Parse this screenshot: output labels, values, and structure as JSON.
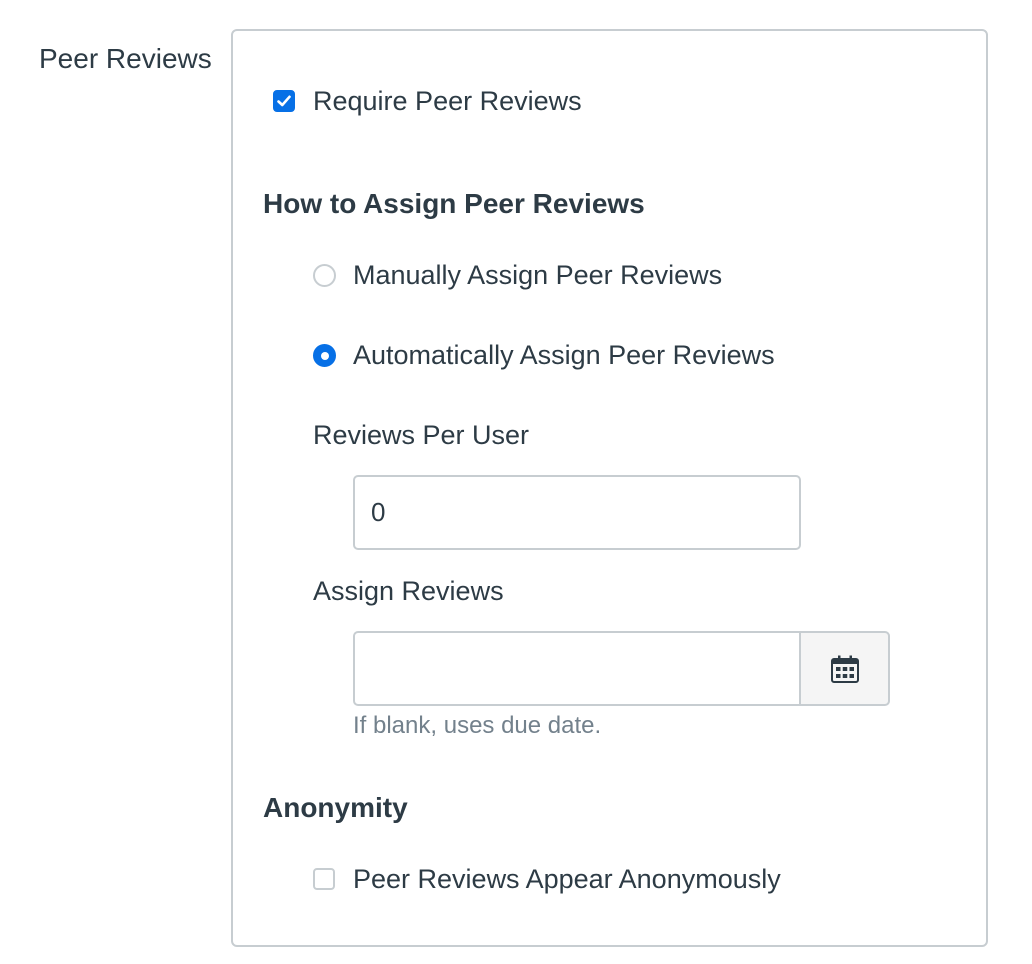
{
  "section": {
    "label": "Peer Reviews"
  },
  "require_peer_reviews": {
    "label": "Require Peer Reviews",
    "checked": true
  },
  "assign_method": {
    "heading": "How to Assign Peer Reviews",
    "options": [
      {
        "label": "Manually Assign Peer Reviews",
        "selected": false
      },
      {
        "label": "Automatically Assign Peer Reviews",
        "selected": true
      }
    ]
  },
  "reviews_per_user": {
    "label": "Reviews Per User",
    "value": "0"
  },
  "assign_reviews": {
    "label": "Assign Reviews",
    "value": "",
    "hint": "If blank, uses due date.",
    "calendar_icon": "calendar-icon"
  },
  "anonymity": {
    "heading": "Anonymity",
    "checkbox_label": "Peer Reviews Appear Anonymously",
    "checked": false
  },
  "colors": {
    "accent": "#0770e6",
    "text": "#2d3b45",
    "border": "#c7cdd1",
    "hint": "#73818c"
  }
}
